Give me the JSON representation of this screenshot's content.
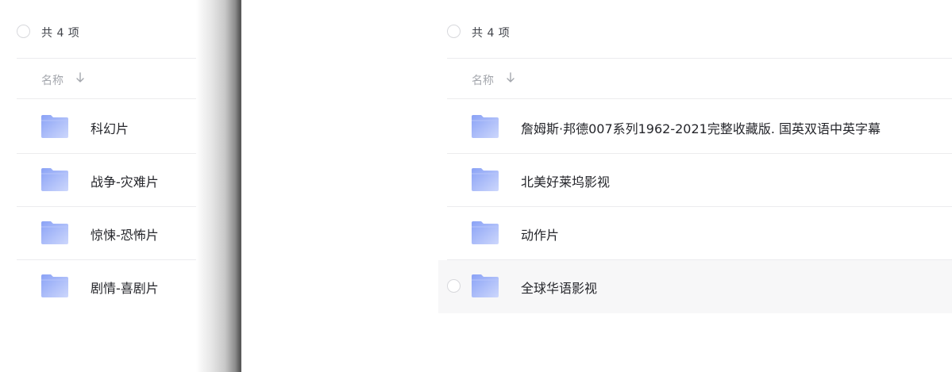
{
  "left_panel": {
    "count_label": "共 4 项",
    "column_name": "名称",
    "sort_icon": "arrow-down-icon",
    "items": [
      {
        "label": "科幻片"
      },
      {
        "label": "战争-灾难片"
      },
      {
        "label": "惊悚-恐怖片"
      },
      {
        "label": "剧情-喜剧片"
      }
    ]
  },
  "right_panel": {
    "count_label": "共 4 项",
    "column_name": "名称",
    "sort_icon": "arrow-down-icon",
    "items": [
      {
        "label": "詹姆斯·邦德007系列1962-2021完整收藏版. 国英双语中英字幕"
      },
      {
        "label": "北美好莱坞影视"
      },
      {
        "label": "动作片"
      },
      {
        "label": "全球华语影视"
      }
    ]
  },
  "colors": {
    "folder_top": "#8fa8f7",
    "folder_bottom": "#c9d4fb",
    "hover_row": "#f7f7f8",
    "divider": "#ececee"
  }
}
